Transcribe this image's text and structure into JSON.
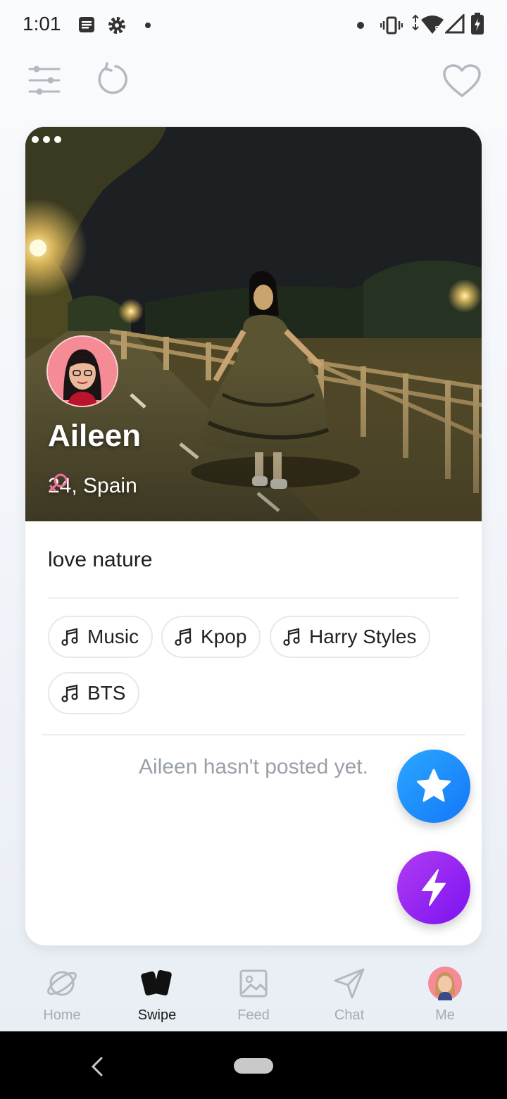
{
  "status_bar": {
    "time": "1:01"
  },
  "top_bar": {
    "filter_icon": "sliders-icon",
    "undo_icon": "undo-icon",
    "like_icon": "heart-outline-icon"
  },
  "profile": {
    "name": "Aileen",
    "age_location": "24, Spain",
    "gender_icon": "female-symbol-icon",
    "bio": "love nature",
    "interests": [
      {
        "label": "Music",
        "icon": "music-note-icon"
      },
      {
        "label": "Kpop",
        "icon": "music-note-icon"
      },
      {
        "label": "Harry Styles",
        "icon": "music-note-icon"
      },
      {
        "label": "BTS",
        "icon": "music-note-icon"
      }
    ],
    "empty_posts_text": "Aileen hasn't posted yet."
  },
  "actions": {
    "star_icon": "star-icon",
    "boost_icon": "lightning-icon"
  },
  "bottom_nav": {
    "active": "Swipe",
    "items": [
      {
        "label": "Home",
        "icon": "planet-icon"
      },
      {
        "label": "Swipe",
        "icon": "cards-icon"
      },
      {
        "label": "Feed",
        "icon": "image-icon"
      },
      {
        "label": "Chat",
        "icon": "send-icon"
      },
      {
        "label": "Me",
        "icon": "avatar-icon"
      }
    ]
  },
  "colors": {
    "star_fab": "#1e90ff",
    "boost_fab": "#9b21f2",
    "gender": "#f36f9b",
    "inactive": "#a7abb2"
  }
}
